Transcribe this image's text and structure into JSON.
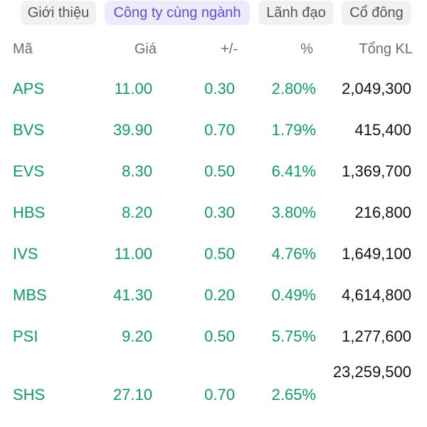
{
  "tabs": [
    {
      "label": "Giới thiệu",
      "active": false
    },
    {
      "label": "Công ty cùng ngành",
      "active": true
    },
    {
      "label": "Lãnh đạo",
      "active": false
    },
    {
      "label": "Cổ đông",
      "active": false
    }
  ],
  "table": {
    "headers": {
      "code": "Mã",
      "price": "Giá",
      "change": "+/-",
      "pct": "%",
      "volume": "Tổng KL"
    },
    "rows": [
      {
        "code": "APS",
        "price": "11.00",
        "change": "0.30",
        "pct": "2.80%",
        "volume": "2,049,300"
      },
      {
        "code": "BVS",
        "price": "39.90",
        "change": "0.70",
        "pct": "1.79%",
        "volume": "415,400"
      },
      {
        "code": "EVS",
        "price": "8.30",
        "change": "0.50",
        "pct": "6.41%",
        "volume": "1,369,700"
      },
      {
        "code": "HBS",
        "price": "8.20",
        "change": "0.30",
        "pct": "3.80%",
        "volume": "216,800"
      },
      {
        "code": "IVS",
        "price": "11.00",
        "change": "0.50",
        "pct": "4.76%",
        "volume": "1,649,100"
      },
      {
        "code": "MBS",
        "price": "41.30",
        "change": "0.20",
        "pct": "0.49%",
        "volume": "4,614,800"
      },
      {
        "code": "PSI",
        "price": "9.20",
        "change": "0.50",
        "pct": "5.75%",
        "volume": "1,277,600"
      },
      {
        "code": "SHS",
        "price": "27.10",
        "change": "0.70",
        "pct": "2.65%",
        "volume": "23,259,500"
      }
    ]
  },
  "colors": {
    "up_green": "#0f9a63",
    "active_tab_text": "#5b4fd6",
    "active_tab_bg": "#ecebfb",
    "tab_bg": "#f1f1f3"
  }
}
